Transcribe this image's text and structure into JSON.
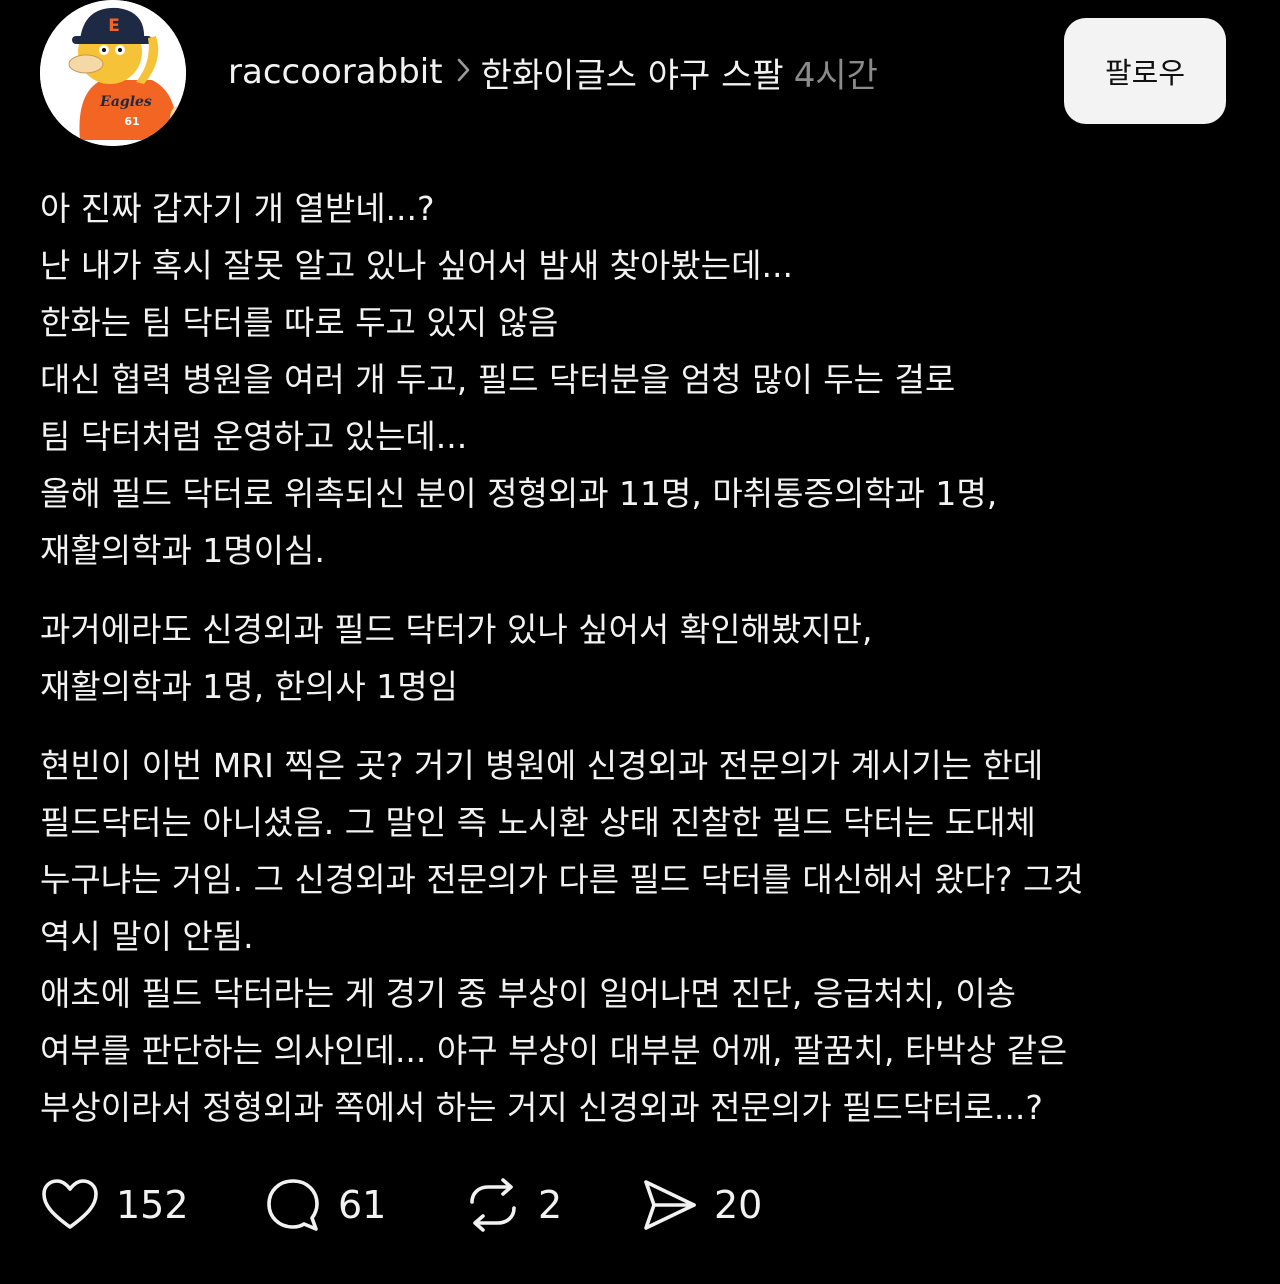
{
  "post": {
    "username": "raccoorabbit",
    "topic": "한화이글스 야구 스팔",
    "time": "4시간",
    "follow_label": "팔로우",
    "avatar_cap_letter": "E",
    "avatar_jersey_text": "Eagles",
    "avatar_jersey_number": "61",
    "paragraphs": [
      [
        "아 진짜 갑자기 개 열받네...?",
        "난 내가 혹시 잘못 알고 있나 싶어서 밤새 찾아봤는데...",
        "한화는 팀 닥터를 따로 두고 있지 않음",
        "대신 협력 병원을 여러 개 두고, 필드 닥터분을 엄청 많이 두는 걸로",
        "팀 닥터처럼 운영하고 있는데...",
        "올해 필드 닥터로 위촉되신 분이 정형외과 11명, 마취통증의학과 1명,",
        "재활의학과 1명이심."
      ],
      [
        "과거에라도 신경외과 필드 닥터가 있나 싶어서 확인해봤지만,",
        "재활의학과 1명, 한의사 1명임"
      ],
      [
        "현빈이 이번 MRI 찍은 곳? 거기 병원에 신경외과 전문의가 계시기는 한데",
        "필드닥터는 아니셨음. 그 말인 즉 노시환 상태 진찰한 필드 닥터는 도대체",
        "누구냐는 거임. 그 신경외과 전문의가 다른 필드 닥터를 대신해서 왔다? 그것",
        "역시 말이 안됨.",
        "애초에 필드 닥터라는 게 경기 중 부상이 일어나면 진단, 응급처치, 이송",
        "여부를 판단하는 의사인데... 야구 부상이 대부분 어깨, 팔꿈치, 타박상 같은",
        "부상이라서 정형외과 쪽에서 하는 거지 신경외과 전문의가 필드닥터로...?"
      ]
    ]
  },
  "actions": {
    "likes": "152",
    "comments": "61",
    "reposts": "2",
    "shares": "20",
    "icons": [
      "heart-icon",
      "comment-icon",
      "repost-icon",
      "share-icon"
    ]
  },
  "colors": {
    "background": "#000000",
    "text": "#f2f2f2",
    "muted": "#8a8a8a",
    "follow_button_bg": "#f3f3f3",
    "avatar_jersey": "#f26522"
  }
}
